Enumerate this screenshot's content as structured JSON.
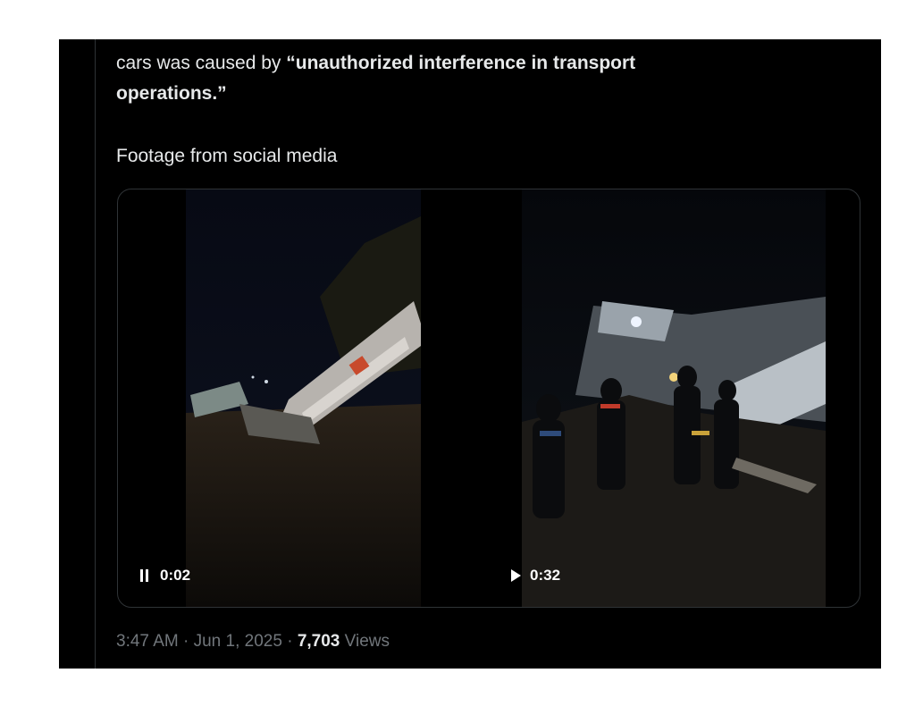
{
  "tweet": {
    "line1_pre": "cars was caused by ",
    "line1_bold": "“unauthorized interference in transport",
    "line2_bold": "operations.”",
    "line3": "Footage from social media"
  },
  "media": {
    "video1": {
      "time": "0:02",
      "control": "pause-icon"
    },
    "video2": {
      "time": "0:32",
      "control": "play-icon"
    }
  },
  "meta": {
    "time": "3:47 AM",
    "separator": "·",
    "date": "Jun 1, 2025",
    "views_count": "7,703",
    "views_label": "Views"
  },
  "colors": {
    "background": "#000000",
    "text": "#e7e9ea",
    "muted": "#71767b",
    "border": "#2f3336"
  }
}
